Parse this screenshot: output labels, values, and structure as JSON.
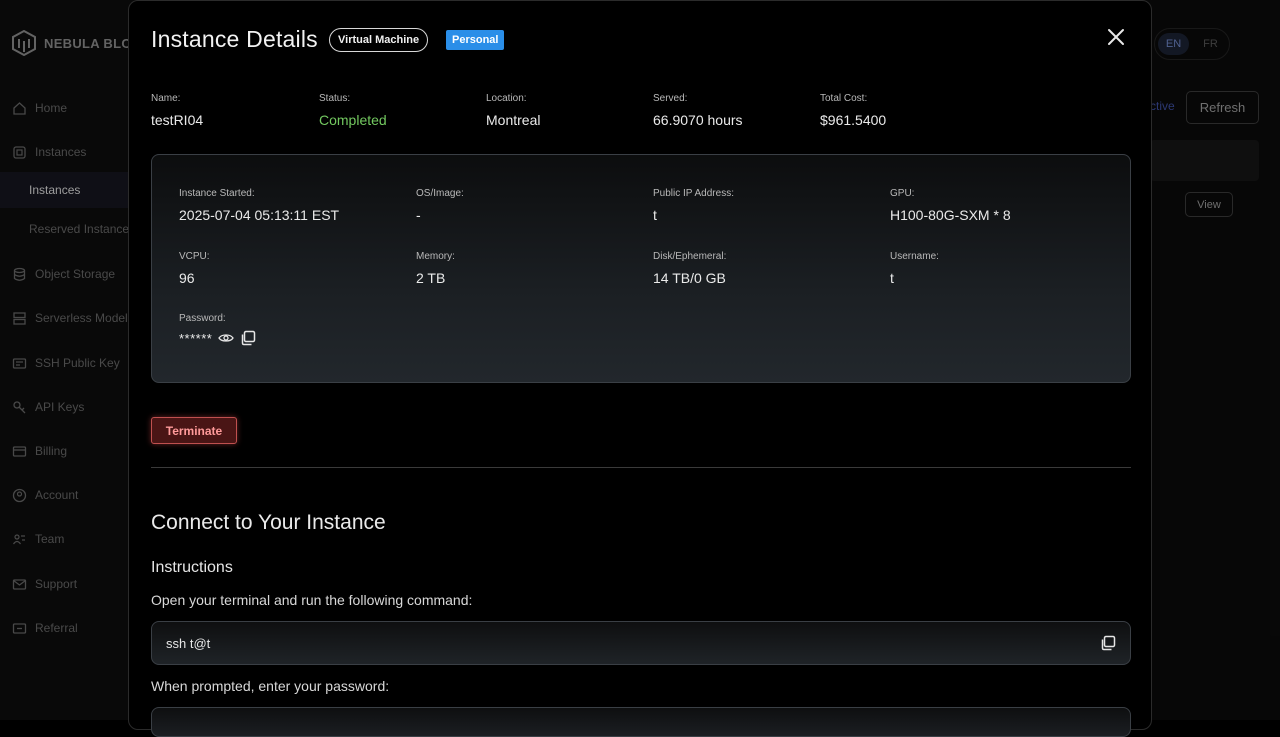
{
  "app": {
    "brand": "NEBULA BLOCK",
    "nav": [
      {
        "label": "Home",
        "icon": "home-icon"
      },
      {
        "label": "Instances",
        "icon": "instances-icon"
      },
      {
        "label": "Instances",
        "icon": "",
        "sub": true,
        "active": true
      },
      {
        "label": "Reserved Instances",
        "icon": "",
        "sub": true
      },
      {
        "label": "Object Storage",
        "icon": "database-icon"
      },
      {
        "label": "Serverless Models",
        "icon": "server-icon"
      },
      {
        "label": "SSH Public Key",
        "icon": "key-card-icon"
      },
      {
        "label": "API Keys",
        "icon": "key-icon"
      },
      {
        "label": "Billing",
        "icon": "billing-icon"
      },
      {
        "label": "Account",
        "icon": "account-icon"
      },
      {
        "label": "Team",
        "icon": "team-icon"
      },
      {
        "label": "Support",
        "icon": "mail-icon"
      },
      {
        "label": "Referral",
        "icon": "referral-icon"
      }
    ],
    "lang": {
      "en": "EN",
      "fr": "FR",
      "selected": "EN"
    },
    "bg_status": "ctive",
    "bg_refresh": "Refresh",
    "bg_view": "View"
  },
  "modal": {
    "title": "Instance Details",
    "type_badge": "Virtual Machine",
    "owner_badge": "Personal",
    "summary": {
      "name_label": "Name:",
      "name": "testRI04",
      "status_label": "Status:",
      "status": "Completed",
      "location_label": "Location:",
      "location": "Montreal",
      "served_label": "Served:",
      "served": "66.9070 hours",
      "cost_label": "Total Cost:",
      "cost": "$961.5400"
    },
    "details": {
      "started_label": "Instance Started:",
      "started": "2025-07-04 05:13:11 EST",
      "os_label": "OS/Image:",
      "os": "-",
      "ip_label": "Public IP Address:",
      "ip": "t",
      "gpu_label": "GPU:",
      "gpu": "H100-80G-SXM * 8",
      "vcpu_label": "VCPU:",
      "vcpu": "96",
      "memory_label": "Memory:",
      "memory": "2 TB",
      "disk_label": "Disk/Ephemeral:",
      "disk": "14 TB/0 GB",
      "username_label": "Username:",
      "username": "t",
      "password_label": "Password:",
      "password": "******"
    },
    "terminate_label": "Terminate",
    "connect_heading": "Connect to Your Instance",
    "instructions_heading": "Instructions",
    "step1": "Open your terminal and run the following command:",
    "command": "ssh t@t",
    "step2": "When prompted, enter your password:"
  },
  "colors": {
    "status_completed": "#73c960",
    "personal_badge": "#2a8ee8",
    "terminate": "#c0504f"
  }
}
